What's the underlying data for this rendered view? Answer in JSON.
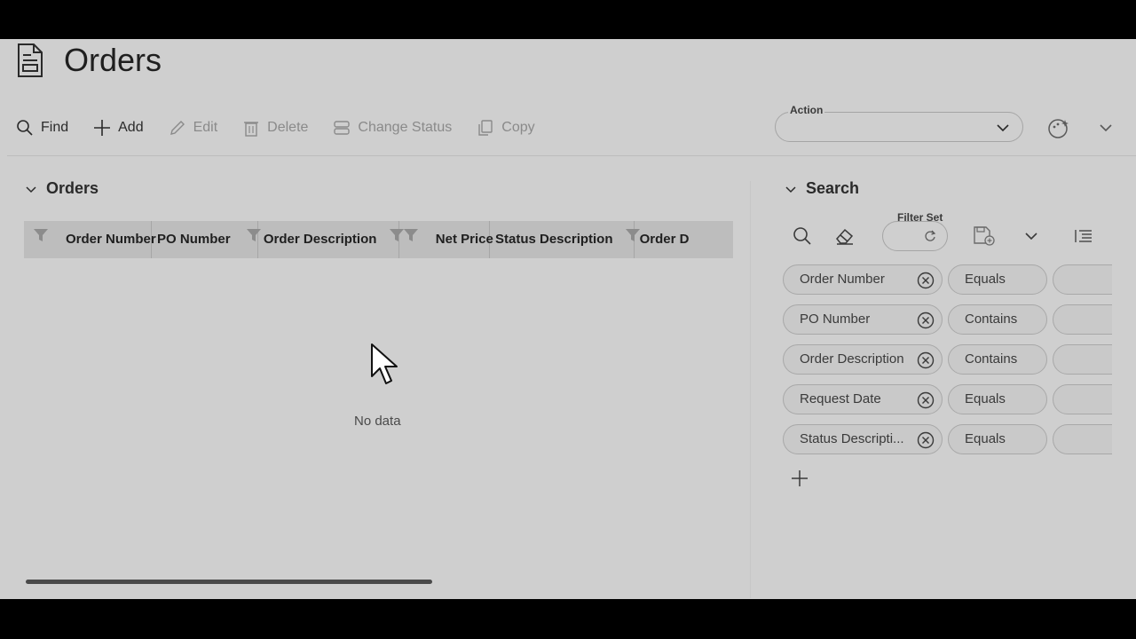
{
  "page": {
    "title": "Orders"
  },
  "toolbar": {
    "buttons": [
      {
        "label": "Find",
        "icon": "search-icon",
        "enabled": true
      },
      {
        "label": "Add",
        "icon": "plus-icon",
        "enabled": true
      },
      {
        "label": "Edit",
        "icon": "pencil-icon",
        "enabled": false
      },
      {
        "label": "Delete",
        "icon": "trash-icon",
        "enabled": false
      },
      {
        "label": "Change Status",
        "icon": "change-status-icon",
        "enabled": false
      },
      {
        "label": "Copy",
        "icon": "copy-icon",
        "enabled": false
      }
    ],
    "action_label": "Action",
    "action_value": ""
  },
  "orders_panel": {
    "title": "Orders",
    "columns": [
      "Order Number",
      "PO Number",
      "Order Description",
      "Net Price",
      "Status Description",
      "Order D"
    ],
    "empty_text": "No data"
  },
  "search_panel": {
    "title": "Search",
    "filter_set_label": "Filter Set",
    "criteria": [
      {
        "field": "Order Number",
        "operator": "Equals"
      },
      {
        "field": "PO Number",
        "operator": "Contains"
      },
      {
        "field": "Order Description",
        "operator": "Contains"
      },
      {
        "field": "Request Date",
        "operator": "Equals"
      },
      {
        "field": "Status Descripti...",
        "operator": "Equals"
      }
    ]
  },
  "colors": {
    "overlay_bg": "#cfcfcf",
    "frame": "#000000",
    "text": "#1f1f1f"
  }
}
